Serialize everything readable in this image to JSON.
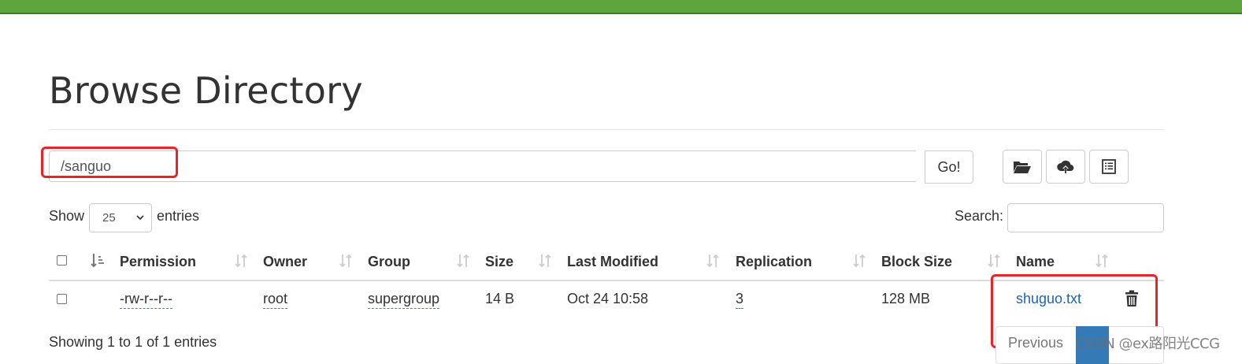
{
  "page": {
    "title": "Browse Directory"
  },
  "colors": {
    "header_bar": "#5ea63c",
    "link": "#1f63b3",
    "highlight": "#e8242b",
    "pagination_active": "#337ab7"
  },
  "path_bar": {
    "value": "/sanguo",
    "go_label": "Go!"
  },
  "toolbar": {
    "icons": [
      "folder-open-icon",
      "cloud-upload-icon",
      "list-icon"
    ]
  },
  "length_menu": {
    "show_label": "Show",
    "selected": "25",
    "entries_label": "entries"
  },
  "search": {
    "label": "Search:",
    "value": ""
  },
  "table": {
    "columns": [
      "Permission",
      "Owner",
      "Group",
      "Size",
      "Last Modified",
      "Replication",
      "Block Size",
      "Name"
    ],
    "rows": [
      {
        "permission": "-rw-r--r--",
        "owner": "root",
        "group": "supergroup",
        "size": "14 B",
        "last_modified": "Oct 24 10:58",
        "replication": "3",
        "block_size": "128 MB",
        "name": "shuguo.txt"
      }
    ]
  },
  "footer": {
    "info": "Showing 1 to 1 of 1 entries",
    "previous_label": "Previous"
  },
  "watermark": "CSDN @ex路阳光CCG"
}
